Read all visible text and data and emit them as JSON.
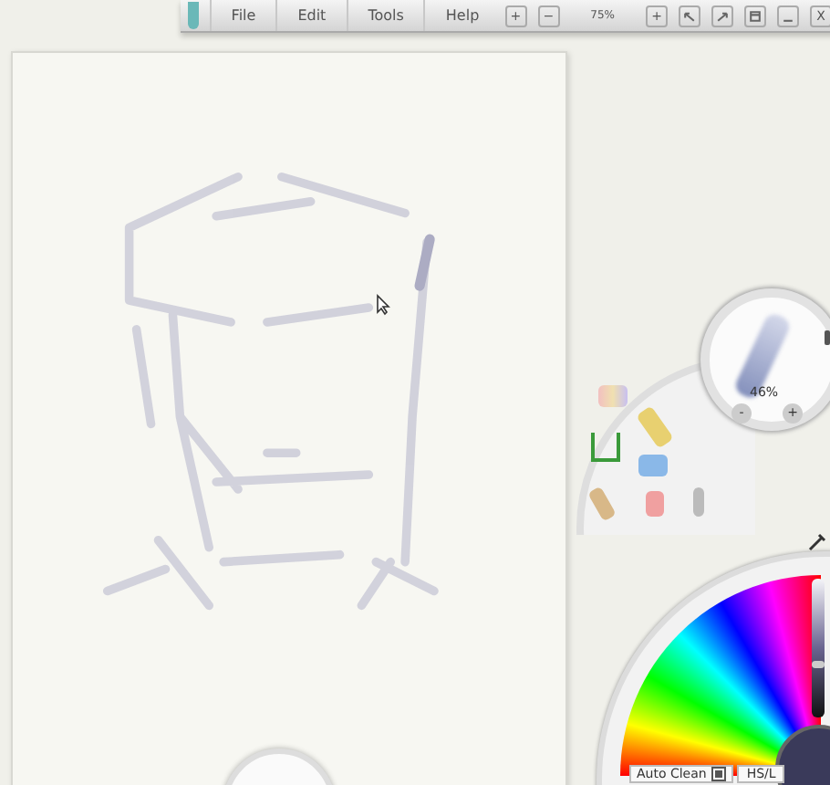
{
  "toolbar": {
    "menus": [
      {
        "label": "File"
      },
      {
        "label": "Edit"
      },
      {
        "label": "Tools"
      },
      {
        "label": "Help"
      }
    ],
    "zoom_out": "+",
    "zoom_minus": "−",
    "zoom": "75%",
    "zoom_in": "+",
    "close": "X"
  },
  "brush": {
    "size": "46%",
    "minus": "-",
    "plus": "+"
  },
  "color_wheel": {
    "lightness": {
      "level": 0.36
    },
    "auto_clean": {
      "label": "Auto Clean",
      "checked": true
    },
    "mode": "HS/L"
  }
}
